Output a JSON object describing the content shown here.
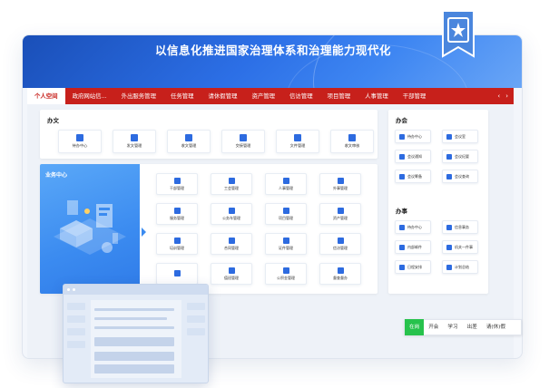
{
  "banner": {
    "title": "以信息化推进国家治理体系和治理能力现代化"
  },
  "nav": {
    "items": [
      "个人空间",
      "政府网站信...",
      "外出服务管理",
      "任务管理",
      "请休假管理",
      "资产管理",
      "信访管理",
      "项目管理",
      "人事管理",
      "干部管理"
    ],
    "active_index": 0,
    "prev_icon": "‹",
    "next_icon": "›"
  },
  "office_docs": {
    "title": "办文",
    "tiles": [
      {
        "label": "待办中心",
        "icon": "inbox-icon"
      },
      {
        "label": "发文管理",
        "icon": "document-icon"
      },
      {
        "label": "收文管理",
        "icon": "document-icon"
      },
      {
        "label": "交接管理",
        "icon": "document-icon"
      },
      {
        "label": "文件管理",
        "icon": "document-icon"
      },
      {
        "label": "收文审核",
        "icon": "document-icon"
      }
    ]
  },
  "business_center": {
    "title": "业务中心",
    "tiles": [
      {
        "label": "干部管理",
        "icon": "user-icon"
      },
      {
        "label": "工会管理",
        "icon": "settings-icon"
      },
      {
        "label": "人事管理",
        "icon": "user-icon"
      },
      {
        "label": "外事管理",
        "icon": "globe-icon"
      },
      {
        "label": "服务管理",
        "icon": "document-icon"
      },
      {
        "label": "公务车管理",
        "icon": "document-icon"
      },
      {
        "label": "项目管理",
        "icon": "document-icon"
      },
      {
        "label": "资产管理",
        "icon": "document-icon"
      },
      {
        "label": "培训管理",
        "icon": "document-icon"
      },
      {
        "label": "合同管理",
        "icon": "document-icon"
      },
      {
        "label": "证件管理",
        "icon": "document-icon"
      },
      {
        "label": "信访管理",
        "icon": "document-icon"
      },
      {
        "label": "",
        "icon": "document-icon"
      },
      {
        "label": "值班管理",
        "icon": "calendar-icon"
      },
      {
        "label": "公积金管理",
        "icon": "chart-icon"
      },
      {
        "label": "督查督办",
        "icon": "document-icon"
      }
    ]
  },
  "office_meeting": {
    "title": "办会",
    "tiles": [
      {
        "label": "待办中心",
        "icon": "inbox-icon"
      },
      {
        "label": "会议室",
        "icon": "document-icon"
      },
      {
        "label": "会议通知",
        "icon": "document-icon"
      },
      {
        "label": "会议纪要",
        "icon": "document-icon"
      },
      {
        "label": "会议筹备",
        "icon": "document-icon"
      },
      {
        "label": "会议查询",
        "icon": "document-icon"
      }
    ]
  },
  "office_affairs": {
    "title": "办事",
    "tiles": [
      {
        "label": "待办中心",
        "icon": "inbox-icon"
      },
      {
        "label": "信息事务",
        "icon": "document-icon"
      },
      {
        "label": "内部邮件",
        "icon": "mail-icon"
      },
      {
        "label": "机关一件事",
        "icon": "document-icon"
      },
      {
        "label": "日程安排",
        "icon": "calendar-icon"
      },
      {
        "label": "计划总结",
        "icon": "document-icon"
      }
    ]
  },
  "status_bar": {
    "items": [
      "在岗",
      "开会",
      "学习",
      "出差",
      "请(休)假"
    ],
    "active_index": 0
  },
  "colors": {
    "nav_red": "#c7201b",
    "brand_blue": "#2d6be0",
    "online_green": "#27c24c"
  }
}
